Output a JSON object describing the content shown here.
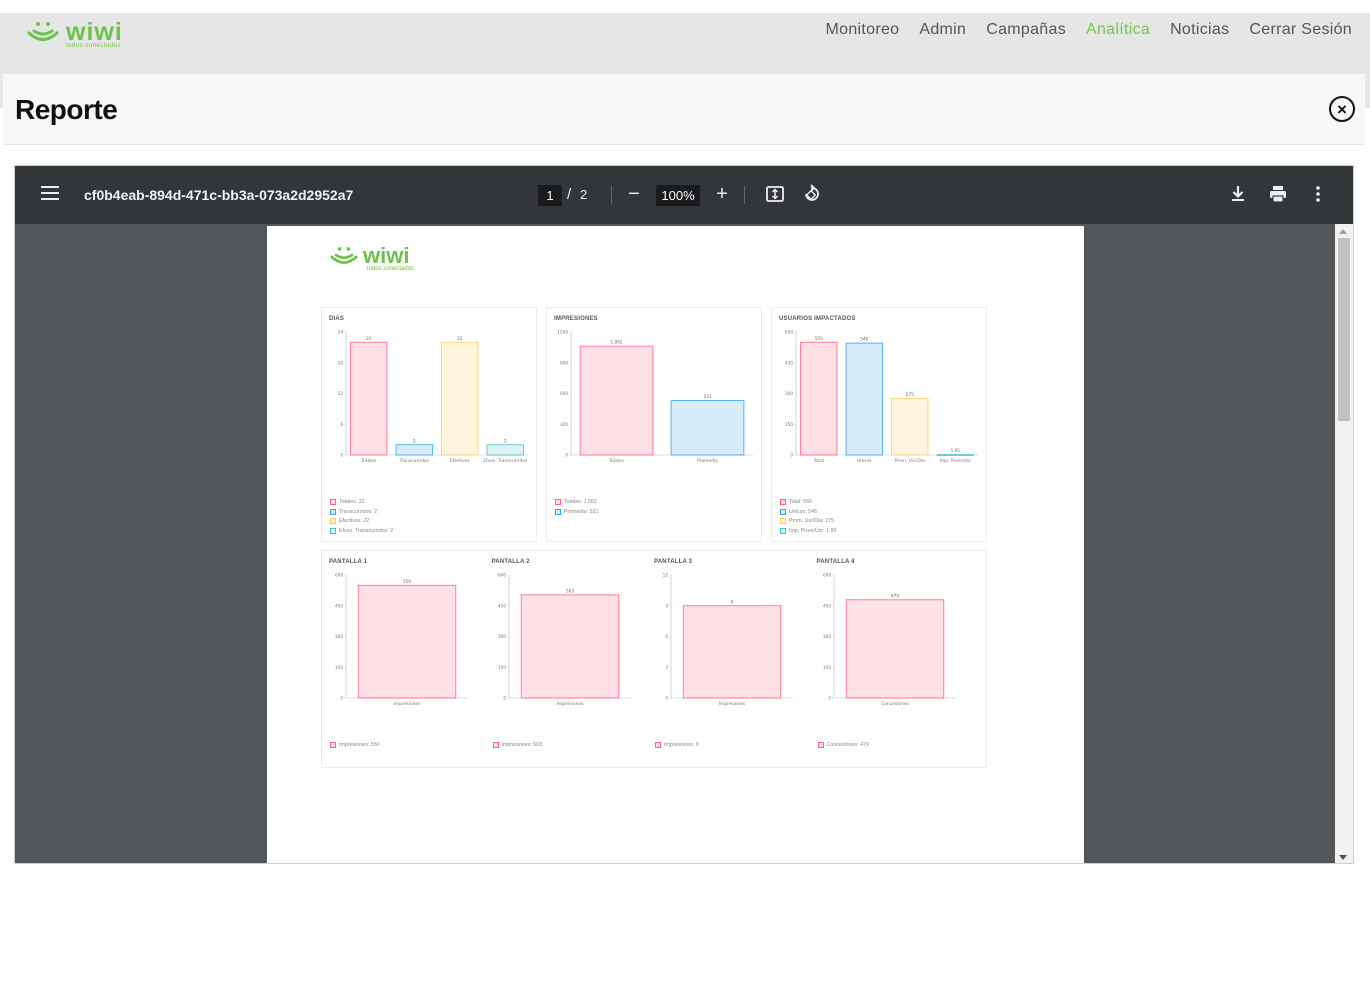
{
  "nav": {
    "brand": "wiwi",
    "brand_tagline": "todos conectados",
    "links": [
      "Monitoreo",
      "Admin",
      "Campañas",
      "Analítica",
      "Noticias",
      "Cerrar Sesión"
    ],
    "active_link": "Analítica",
    "accent_color": "#78c850"
  },
  "panel": {
    "title": "Reporte",
    "close_icon": "close-circle-icon"
  },
  "viewer": {
    "filename": "cf0b4eab-894d-471c-bb3a-073a2d2952a7",
    "page_current": "1",
    "page_separator": "/",
    "page_total": "2",
    "zoom": "100%",
    "icons": [
      "menu-icon",
      "zoom-out-icon",
      "zoom-in-icon",
      "fit-page-icon",
      "rotate-icon",
      "download-icon",
      "print-icon",
      "more-vert-icon"
    ]
  },
  "pdf": {
    "logo": "wiwi",
    "logo_tagline": "todos conectados"
  },
  "chart_data": [
    {
      "title": "DIAS",
      "type": "bar",
      "categories": [
        "Totales",
        "Transcurridos",
        "Efectivos",
        "Efvos. Transcurridos"
      ],
      "values": [
        22,
        2,
        22,
        2
      ],
      "labels": [
        "22",
        "2",
        "22",
        "2"
      ],
      "yticks": [
        "0",
        "6",
        "12",
        "18",
        "24"
      ],
      "ylim": [
        0,
        24
      ],
      "colors": [
        "#ff6384",
        "#36a2eb",
        "#ffcd56",
        "#4bc0c0"
      ],
      "legend": [
        "Totales: 22",
        "Transcurridos: 2",
        "Efectivos: 22",
        "Efvos. Transcurridos: 2"
      ]
    },
    {
      "title": "IMPRESIONES",
      "type": "bar",
      "categories": [
        "Totales",
        "Promedio"
      ],
      "values": [
        1062,
        531
      ],
      "labels": [
        "1,062",
        "531"
      ],
      "yticks": [
        "0",
        "300",
        "600",
        "900",
        "1200"
      ],
      "ylim": [
        0,
        1200
      ],
      "colors": [
        "#ff6384",
        "#36a2eb"
      ],
      "legend": [
        "Totales: 1,062",
        "Promedio: 531"
      ]
    },
    {
      "title": "USUARIOS IMPACTADOS",
      "type": "bar",
      "categories": [
        "Total",
        "Unicos",
        "Prom. Usr/Dia",
        "Imp. Prom/Usr"
      ],
      "values": [
        550,
        546,
        275,
        1.95
      ],
      "labels": [
        "550",
        "546",
        "275",
        "1.95"
      ],
      "yticks": [
        "0",
        "150",
        "300",
        "450",
        "600"
      ],
      "ylim": [
        0,
        600
      ],
      "colors": [
        "#ff6384",
        "#36a2eb",
        "#ffcd56",
        "#4bc0c0"
      ],
      "legend": [
        "Total: 550",
        "Unicos: 546",
        "Prom. Usr/Dia: 275",
        "Imp. Prom/Usr: 1.95"
      ]
    },
    {
      "title": "PANTALLA 1",
      "type": "bar",
      "categories": [
        "Impresiones"
      ],
      "values": [
        550
      ],
      "labels": [
        "550"
      ],
      "yticks": [
        "0",
        "150",
        "300",
        "450",
        "600"
      ],
      "ylim": [
        0,
        600
      ],
      "colors": [
        "#ff6384"
      ],
      "legend": [
        "Impresiones: 550"
      ]
    },
    {
      "title": "PANTALLA 2",
      "type": "bar",
      "categories": [
        "Impresiones"
      ],
      "values": [
        503
      ],
      "labels": [
        "503"
      ],
      "yticks": [
        "0",
        "150",
        "300",
        "450",
        "600"
      ],
      "ylim": [
        0,
        600
      ],
      "colors": [
        "#ff6384"
      ],
      "legend": [
        "Impresiones: 503"
      ]
    },
    {
      "title": "PANTALLA 3",
      "type": "bar",
      "categories": [
        "Impresiones"
      ],
      "values": [
        9
      ],
      "labels": [
        "9"
      ],
      "yticks": [
        "0",
        "3",
        "6",
        "9",
        "12"
      ],
      "ylim": [
        0,
        12
      ],
      "colors": [
        "#ff6384"
      ],
      "legend": [
        "Impresiones: 9"
      ]
    },
    {
      "title": "PANTALLA 4",
      "type": "bar",
      "categories": [
        "Concesiones"
      ],
      "values": [
        479
      ],
      "labels": [
        "479"
      ],
      "yticks": [
        "0",
        "150",
        "300",
        "450",
        "600"
      ],
      "ylim": [
        0,
        600
      ],
      "colors": [
        "#ff6384"
      ],
      "legend": [
        "Concesiones: 479"
      ]
    }
  ]
}
